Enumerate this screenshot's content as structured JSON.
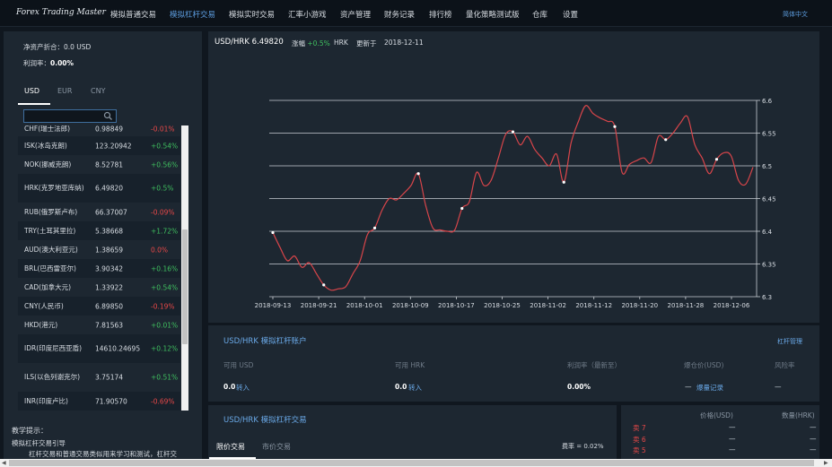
{
  "nav": {
    "brand": "Forex Trading Master",
    "items": [
      "模拟普通交易",
      "模拟杠杆交易",
      "模拟实时交易",
      "汇率小游戏",
      "资产管理",
      "财务记录",
      "排行榜",
      "量化策略测试版",
      "仓库",
      "设置"
    ],
    "active_index": 1,
    "lang": "简体中文"
  },
  "left": {
    "net_assets_label": "净资产折合：",
    "net_assets_value": "0.0 USD",
    "profit_label": "利润率：",
    "profit_value": "0.00%",
    "tabs": [
      "USD",
      "EUR",
      "CNY"
    ],
    "active_tab": 0,
    "search_placeholder": "",
    "rows": [
      {
        "name": "CHF(瑞士法郎)",
        "price": "0.98849",
        "change": "-0.01%",
        "dir": "down"
      },
      {
        "name": "ISK(冰岛克朗)",
        "price": "123.20942",
        "change": "+0.54%",
        "dir": "up"
      },
      {
        "name": "NOK(挪威克朗)",
        "price": "8.52781",
        "change": "+0.56%",
        "dir": "up"
      },
      {
        "name": "HRK(克罗地亚库纳)",
        "price": "6.49820",
        "change": "+0.5%",
        "dir": "up"
      },
      {
        "name": "RUB(俄罗斯卢布)",
        "price": "66.37007",
        "change": "-0.09%",
        "dir": "down"
      },
      {
        "name": "TRY(土耳其里拉)",
        "price": "5.38668",
        "change": "+1.72%",
        "dir": "up"
      },
      {
        "name": "AUD(澳大利亚元)",
        "price": "1.38659",
        "change": "0.0%",
        "dir": "down"
      },
      {
        "name": "BRL(巴西雷亚尔)",
        "price": "3.90342",
        "change": "+0.16%",
        "dir": "up"
      },
      {
        "name": "CAD(加拿大元)",
        "price": "1.33922",
        "change": "+0.54%",
        "dir": "up"
      },
      {
        "name": "CNY(人民币)",
        "price": "6.89850",
        "change": "-0.19%",
        "dir": "down"
      },
      {
        "name": "HKD(港元)",
        "price": "7.81563",
        "change": "+0.01%",
        "dir": "up"
      },
      {
        "name": "IDR(印度尼西亚盾)",
        "price": "14610.24695",
        "change": "+0.12%",
        "dir": "up"
      },
      {
        "name": "ILS(以色列谢克尔)",
        "price": "3.75174",
        "change": "+0.51%",
        "dir": "up"
      },
      {
        "name": "INR(印度卢比)",
        "price": "71.90570",
        "change": "-0.69%",
        "dir": "down"
      }
    ],
    "tips_title": "教学提示：",
    "tips_line1": "模拟杠杆交易引导",
    "tips_line2": "杠杆交易和普通交易类似用来学习和测试，杠杆交"
  },
  "chart_header": {
    "pair": "USD/HRK",
    "price": "6.49820",
    "change_label": "涨幅",
    "change": "+0.5%",
    "currency": "HRK",
    "updated_label": "更新于",
    "date": "2018-12-11"
  },
  "chart_data": {
    "type": "line",
    "x_ticks": [
      "2018-09-13",
      "2018-09-21",
      "2018-10-01",
      "2018-10-09",
      "2018-10-17",
      "2018-10-25",
      "2018-11-02",
      "2018-11-12",
      "2018-11-20",
      "2018-11-28",
      "2018-12-06"
    ],
    "y_ticks": [
      "6.3",
      "6.35",
      "6.4",
      "6.45",
      "6.5",
      "6.55",
      "6.6"
    ],
    "ylim": [
      6.3,
      6.6
    ],
    "grid": true,
    "y_axis_side": "right",
    "values": [
      6.398,
      6.375,
      6.355,
      6.362,
      6.345,
      6.352,
      6.335,
      6.318,
      6.31,
      6.312,
      6.315,
      6.335,
      6.355,
      6.395,
      6.405,
      6.432,
      6.45,
      6.448,
      6.458,
      6.47,
      6.488,
      6.44,
      6.405,
      6.402,
      6.4,
      6.402,
      6.435,
      6.445,
      6.49,
      6.47,
      6.478,
      6.512,
      6.548,
      6.552,
      6.532,
      6.545,
      6.525,
      6.512,
      6.5,
      6.518,
      6.475,
      6.535,
      6.568,
      6.592,
      6.58,
      6.573,
      6.568,
      6.56,
      6.49,
      6.502,
      6.508,
      6.512,
      6.505,
      6.545,
      6.54,
      6.55,
      6.565,
      6.575,
      6.532,
      6.512,
      6.488,
      6.51,
      6.52,
      6.515,
      6.478,
      6.472,
      6.498
    ],
    "markers": [
      0,
      7,
      14,
      20,
      26,
      33,
      40,
      47,
      54,
      61
    ],
    "color": "#d8454a"
  },
  "account": {
    "title": "USD/HRK 模拟杠杆账户",
    "manage": "杠杆管理",
    "labels": [
      "可用 USD",
      "可用 HRK",
      "利润率（最新至）",
      "爆仓价(USD)",
      "风险率"
    ],
    "usd_value": "0.0",
    "hrk_value": "0.0",
    "profit_value": "0.00%",
    "transfer_label": "转入",
    "liq_dash": "—",
    "liq_record": "爆量记录",
    "risk_value": "—"
  },
  "trade": {
    "title": "USD/HRK 模拟杠杆交易",
    "tabs": [
      "限价交易",
      "市价交易"
    ],
    "fee": "费率 = 0.02%"
  },
  "orderbook": {
    "price_header": "价格(USD)",
    "qty_header": "数量(HRK)",
    "rows": [
      {
        "label": "卖 7",
        "price": "—",
        "qty": "—"
      },
      {
        "label": "卖 6",
        "price": "—",
        "qty": "—"
      },
      {
        "label": "卖 5",
        "price": "—",
        "qty": "—"
      }
    ]
  },
  "colors": {
    "accent": "#5d9de0",
    "up": "#3fbf5f",
    "down": "#e84848",
    "panel": "#1d2731",
    "background": "#10171f"
  }
}
